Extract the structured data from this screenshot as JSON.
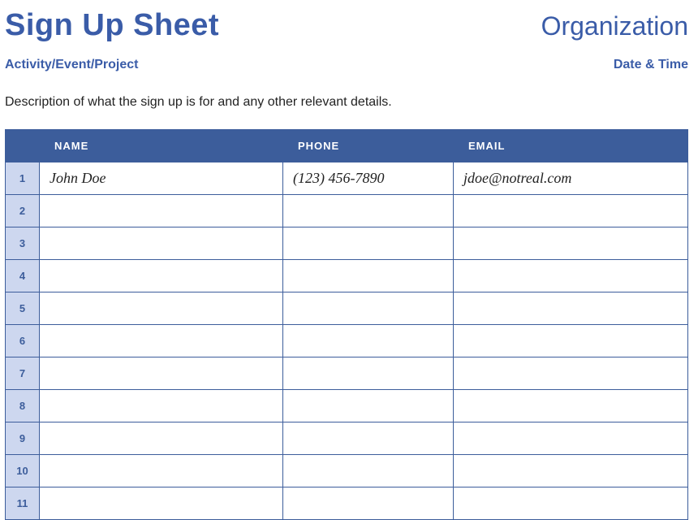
{
  "header": {
    "title": "Sign Up Sheet",
    "organization": "Organization",
    "activity": "Activity/Event/Project",
    "datetime": "Date & Time"
  },
  "description": "Description of what the sign up is for and any other relevant details.",
  "columns": {
    "name": "NAME",
    "phone": "PHONE",
    "email": "EMAIL"
  },
  "rows": [
    {
      "num": "1",
      "name": "John Doe",
      "phone": "(123) 456-7890",
      "email": "jdoe@notreal.com"
    },
    {
      "num": "2",
      "name": "",
      "phone": "",
      "email": ""
    },
    {
      "num": "3",
      "name": "",
      "phone": "",
      "email": ""
    },
    {
      "num": "4",
      "name": "",
      "phone": "",
      "email": ""
    },
    {
      "num": "5",
      "name": "",
      "phone": "",
      "email": ""
    },
    {
      "num": "6",
      "name": "",
      "phone": "",
      "email": ""
    },
    {
      "num": "7",
      "name": "",
      "phone": "",
      "email": ""
    },
    {
      "num": "8",
      "name": "",
      "phone": "",
      "email": ""
    },
    {
      "num": "9",
      "name": "",
      "phone": "",
      "email": ""
    },
    {
      "num": "10",
      "name": "",
      "phone": "",
      "email": ""
    },
    {
      "num": "11",
      "name": "",
      "phone": "",
      "email": ""
    }
  ]
}
